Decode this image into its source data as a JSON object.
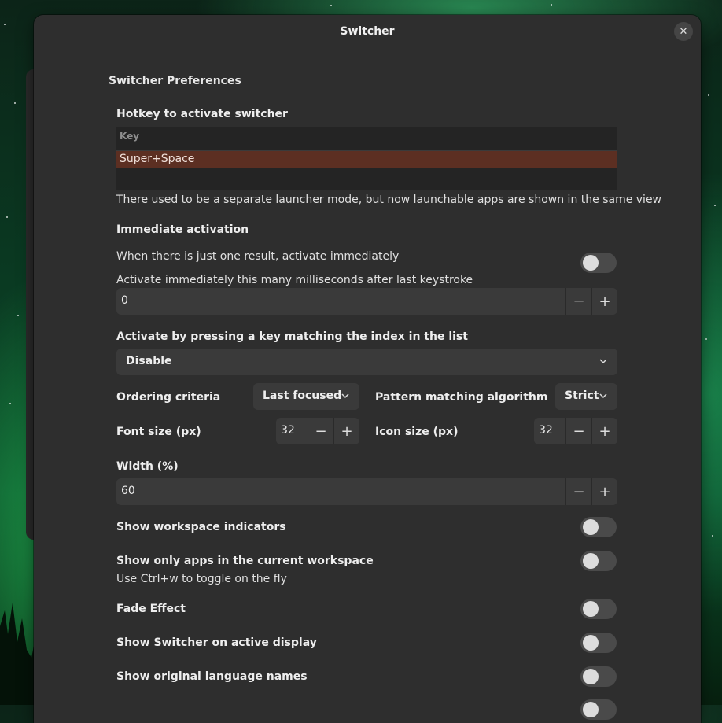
{
  "window": {
    "title": "Switcher"
  },
  "section_title": "Switcher Preferences",
  "hotkey": {
    "label": "Hotkey to activate switcher",
    "column_header": "Key",
    "rows": [
      "Super+Space"
    ],
    "note": "There used to be a separate launcher mode, but now launchable apps are shown in the same view"
  },
  "immediate": {
    "label": "Immediate activation",
    "one_result_text": "When there is just one result, activate immediately",
    "one_result_on": false,
    "delay_text": "Activate immediately this many milliseconds after last keystroke",
    "delay_value": "0"
  },
  "index_key": {
    "label": "Activate by pressing a key matching the index in the list",
    "selected": "Disable"
  },
  "ordering": {
    "label": "Ordering criteria",
    "selected": "Last focused"
  },
  "matching": {
    "label": "Pattern matching algorithm",
    "selected": "Strict"
  },
  "font_size": {
    "label": "Font size (px)",
    "value": "32"
  },
  "icon_size": {
    "label": "Icon size (px)",
    "value": "32"
  },
  "width": {
    "label": "Width (%)",
    "value": "60"
  },
  "toggles": {
    "workspace_indicators": {
      "label": "Show workspace indicators",
      "on": false
    },
    "current_workspace": {
      "label": "Show only apps in the current workspace",
      "sub": "Use Ctrl+w to toggle on the fly",
      "on": false
    },
    "fade": {
      "label": "Fade Effect",
      "on": false
    },
    "active_display": {
      "label": "Show Switcher on active display",
      "on": false
    },
    "language_names": {
      "label": "Show original language names",
      "on": false
    }
  },
  "icons": {
    "minus": "−",
    "plus": "+",
    "close": "✕"
  }
}
